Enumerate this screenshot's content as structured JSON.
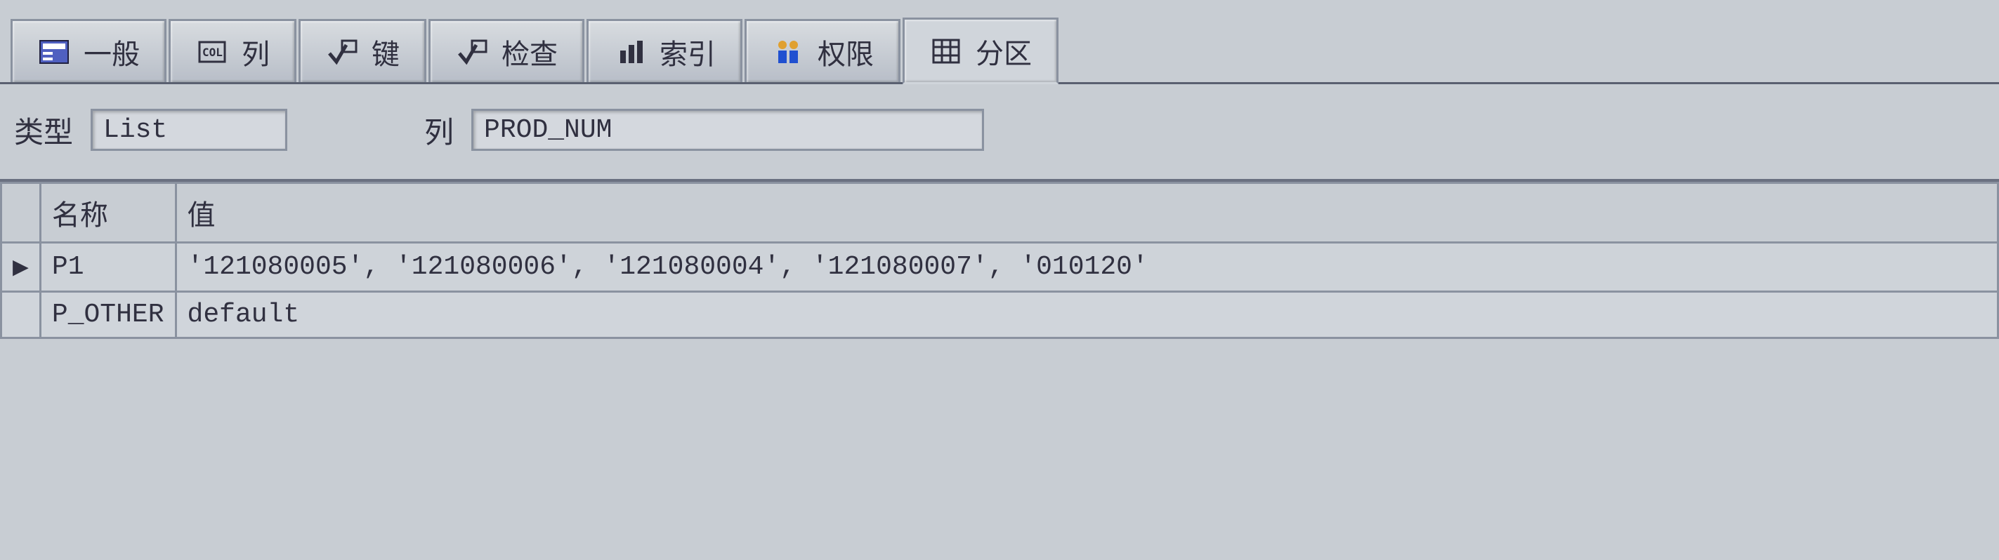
{
  "tabs": {
    "general": "一般",
    "columns": "列",
    "keys": "键",
    "checks": "检查",
    "indexes": "索引",
    "privileges": "权限",
    "partitions": "分区"
  },
  "form": {
    "type_label": "类型",
    "type_value": "List",
    "column_label": "列",
    "column_value": "PROD_NUM"
  },
  "grid": {
    "headers": {
      "name": "名称",
      "value": "值"
    },
    "rows": [
      {
        "indicator": "▶",
        "name": "P1",
        "value": "'121080005', '121080006', '121080004', '121080007', '010120'"
      },
      {
        "indicator": "",
        "name": "P_OTHER",
        "value": "default"
      }
    ]
  }
}
